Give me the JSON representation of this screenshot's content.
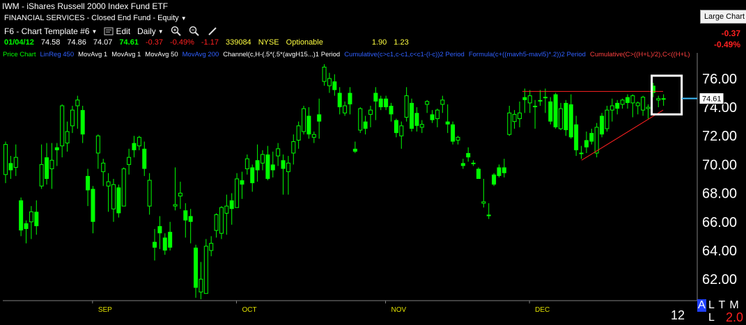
{
  "window": {
    "symbol": "IWM",
    "sep": " - ",
    "name": "iShares Russell 2000 Index Fund ETF",
    "sector": "FINANCIAL SERVICES - Closed End Fund - Equity"
  },
  "toolbar": {
    "template": "F6 - Chart Template #6",
    "edit": "Edit",
    "period": "Daily"
  },
  "quote": {
    "date": "01/04/12",
    "open": "74.58",
    "high": "74.86",
    "low": "74.07",
    "last": "74.61",
    "net": "-0.37",
    "pct": "-0.49%",
    "other": "-1.17",
    "volume": "339084",
    "exchange": "NYSE",
    "optionable": "Optionable",
    "v1": "1.90",
    "v2": "1.23"
  },
  "studies": [
    {
      "text": "Price Chart",
      "color": "green"
    },
    {
      "text": "LinReg 450",
      "color": "blue"
    },
    {
      "text": "MovAvg 1",
      "color": "white"
    },
    {
      "text": "MovAvg 1",
      "color": "white"
    },
    {
      "text": "MovAvg 50",
      "color": "white"
    },
    {
      "text": "MovAvg 200",
      "color": "blue"
    },
    {
      "text": "Channel(c,H-(.5*(.5*(avgH15...)1 Period",
      "color": "white"
    },
    {
      "text": "Cumulative(c>c1,c-c1,c<c1-(l-c))2 Period",
      "color": "blue"
    },
    {
      "text": "Formula(c+((mavh5-mavl5)*.2))2 Period",
      "color": "blue"
    },
    {
      "text": "Cumulative(C>((H+L)/2),C<((H+L)",
      "color": "red"
    }
  ],
  "large_chart_label": "Large Chart",
  "right_change": {
    "net": "-0.37",
    "pct": "-0.49%"
  },
  "last_price_tag": "74.61",
  "footer": {
    "period_num": "12",
    "a": "A",
    "ltml": "L T M L",
    "zoom": "2.0"
  },
  "colors": {
    "up": "#00ff00",
    "down": "#00ff00",
    "trend": "#ff2020",
    "price_tag": "#40c0ff",
    "highlight": "#ffffff"
  },
  "chart_data": {
    "type": "candlestick",
    "ylim": [
      60.5,
      77.5
    ],
    "yticks": [
      "76.00",
      "74.00",
      "72.00",
      "70.00",
      "68.00",
      "66.00",
      "64.00",
      "62.00"
    ],
    "months": [
      "SEP",
      "OCT",
      "NOV",
      "DEC"
    ],
    "candles": [
      [
        69.3,
        71.6,
        68.7,
        71.4
      ],
      [
        70.1,
        70.6,
        69.0,
        69.6
      ],
      [
        69.8,
        71.4,
        69.2,
        70.5
      ],
      [
        67.5,
        67.7,
        65.0,
        65.4
      ],
      [
        65.9,
        66.1,
        64.5,
        65.5
      ],
      [
        66.0,
        67.1,
        64.8,
        66.7
      ],
      [
        66.7,
        67.5,
        65.1,
        65.7
      ],
      [
        68.5,
        71.4,
        68.3,
        70.0
      ],
      [
        70.5,
        71.5,
        68.6,
        69.0
      ],
      [
        69.7,
        71.5,
        68.3,
        70.3
      ],
      [
        71.2,
        71.5,
        69.9,
        71.0
      ],
      [
        71.3,
        74.2,
        70.5,
        74.1
      ],
      [
        71.5,
        73.0,
        70.9,
        72.3
      ],
      [
        72.7,
        74.1,
        72.2,
        73.8
      ],
      [
        74.1,
        74.8,
        72.5,
        74.5
      ],
      [
        73.8,
        74.1,
        71.5,
        72.1
      ],
      [
        69.2,
        69.7,
        67.1,
        68.2
      ],
      [
        68.3,
        68.5,
        65.2,
        66.0
      ],
      [
        70.8,
        72.1,
        69.7,
        72.0
      ],
      [
        69.5,
        70.4,
        68.5,
        70.1
      ],
      [
        68.5,
        69.4,
        66.7,
        68.8
      ],
      [
        66.9,
        69.0,
        66.0,
        68.6
      ],
      [
        68.4,
        68.6,
        66.3,
        66.6
      ],
      [
        67.1,
        69.8,
        67.1,
        69.7
      ],
      [
        70.0,
        71.1,
        69.3,
        70.5
      ],
      [
        71.5,
        72.0,
        70.5,
        71.0
      ],
      [
        71.3,
        72.0,
        71.0,
        71.9
      ],
      [
        71.1,
        71.6,
        69.2,
        69.7
      ],
      [
        67.1,
        69.4,
        66.5,
        68.9
      ],
      [
        64.6,
        65.5,
        63.3,
        64.2
      ],
      [
        65.7,
        66.4,
        64.1,
        65.2
      ],
      [
        64.9,
        65.2,
        63.7,
        64.0
      ],
      [
        65.3,
        66.0,
        64.0,
        64.2
      ],
      [
        67.1,
        69.8,
        66.8,
        67.2
      ],
      [
        67.8,
        68.8,
        66.9,
        68.0
      ],
      [
        66.8,
        67.3,
        64.9,
        66.1
      ],
      [
        66.4,
        66.9,
        64.5,
        66.0
      ],
      [
        64.2,
        64.4,
        60.7,
        61.4
      ],
      [
        61.1,
        63.2,
        60.6,
        62.0
      ],
      [
        61.0,
        64.8,
        61.0,
        64.3
      ],
      [
        64.0,
        65.0,
        63.6,
        64.5
      ],
      [
        65.4,
        66.6,
        64.9,
        66.5
      ],
      [
        65.2,
        67.1,
        64.8,
        67.0
      ],
      [
        66.6,
        67.9,
        65.1,
        67.1
      ],
      [
        67.5,
        68.0,
        65.8,
        66.9
      ],
      [
        67.0,
        69.4,
        67.0,
        69.0
      ],
      [
        68.9,
        69.5,
        67.6,
        68.6
      ],
      [
        69.7,
        70.7,
        69.3,
        70.4
      ],
      [
        69.8,
        70.0,
        68.1,
        68.7
      ],
      [
        70.3,
        71.4,
        68.8,
        69.6
      ],
      [
        70.1,
        71.0,
        69.6,
        70.7
      ],
      [
        70.7,
        71.3,
        68.9,
        69.0
      ],
      [
        70.0,
        70.9,
        69.1,
        69.6
      ],
      [
        70.6,
        71.5,
        69.9,
        71.1
      ],
      [
        70.3,
        70.7,
        67.9,
        69.7
      ],
      [
        69.5,
        70.6,
        67.9,
        70.1
      ],
      [
        70.8,
        72.1,
        70.0,
        71.6
      ],
      [
        71.7,
        73.0,
        71.1,
        72.7
      ],
      [
        72.3,
        74.1,
        72.1,
        73.9
      ],
      [
        73.4,
        74.0,
        71.8,
        72.1
      ],
      [
        71.9,
        72.3,
        71.5,
        72.1
      ],
      [
        73.5,
        74.6,
        71.8,
        73.0
      ],
      [
        75.8,
        77.0,
        75.5,
        76.8
      ],
      [
        75.5,
        76.4,
        75.0,
        76.0
      ],
      [
        75.8,
        76.3,
        74.8,
        75.2
      ],
      [
        75.0,
        75.4,
        73.5,
        74.0
      ],
      [
        73.6,
        74.4,
        73.4,
        74.1
      ],
      [
        75.0,
        75.4,
        73.5,
        74.2
      ],
      [
        71.1,
        71.6,
        70.8,
        70.9
      ],
      [
        72.4,
        74.0,
        72.2,
        73.9
      ],
      [
        73.0,
        73.4,
        72.1,
        72.5
      ],
      [
        73.5,
        74.1,
        72.6,
        73.8
      ],
      [
        75.0,
        75.4,
        73.1,
        74.4
      ],
      [
        74.6,
        74.8,
        73.8,
        74.0
      ],
      [
        74.6,
        74.8,
        73.8,
        74.0
      ],
      [
        74.1,
        74.3,
        73.0,
        73.5
      ],
      [
        73.1,
        73.2,
        71.9,
        72.2
      ],
      [
        72.0,
        73.0,
        71.1,
        72.7
      ],
      [
        73.3,
        75.4,
        73.0,
        74.8
      ],
      [
        74.3,
        74.6,
        72.3,
        72.5
      ],
      [
        73.6,
        74.0,
        72.3,
        72.7
      ],
      [
        72.6,
        73.1,
        72.2,
        72.8
      ],
      [
        74.2,
        74.5,
        73.6,
        74.4
      ],
      [
        73.5,
        73.8,
        72.9,
        73.1
      ],
      [
        73.2,
        73.9,
        72.6,
        73.8
      ],
      [
        74.2,
        74.8,
        73.6,
        74.5
      ],
      [
        73.0,
        74.2,
        72.2,
        72.8
      ],
      [
        72.8,
        73.0,
        71.4,
        71.6
      ],
      [
        71.7,
        72.0,
        71.4,
        71.9
      ],
      [
        70.1,
        70.4,
        69.7,
        69.9
      ],
      [
        70.8,
        71.2,
        70.2,
        70.5
      ],
      [
        70.1,
        70.3,
        69.9,
        70.1
      ],
      [
        69.7,
        69.8,
        69.0,
        69.0
      ],
      [
        67.3,
        69.0,
        67.0,
        67.4
      ],
      [
        66.5,
        67.3,
        66.2,
        66.4
      ],
      [
        69.3,
        69.4,
        68.5,
        68.6
      ],
      [
        69.8,
        70.0,
        69.1,
        69.2
      ],
      [
        69.8,
        70.4,
        69.1,
        69.4
      ],
      [
        72.1,
        74.1,
        72.0,
        73.6
      ],
      [
        73.0,
        73.8,
        72.5,
        73.5
      ],
      [
        73.2,
        74.4,
        72.6,
        73.6
      ],
      [
        74.7,
        75.3,
        73.6,
        74.5
      ],
      [
        74.3,
        75.2,
        73.6,
        74.8
      ],
      [
        74.1,
        74.5,
        72.5,
        74.0
      ],
      [
        74.5,
        75.2,
        74.1,
        74.4
      ],
      [
        74.7,
        75.3,
        73.6,
        74.7
      ],
      [
        74.4,
        74.7,
        72.8,
        73.0
      ],
      [
        74.9,
        75.0,
        72.5,
        72.6
      ],
      [
        72.5,
        74.3,
        72.4,
        73.9
      ],
      [
        74.3,
        74.5,
        72.0,
        72.4
      ],
      [
        74.2,
        74.9,
        71.8,
        71.9
      ],
      [
        72.8,
        73.4,
        70.6,
        71.0
      ],
      [
        70.8,
        71.3,
        70.4,
        70.8
      ],
      [
        71.7,
        72.3,
        70.8,
        71.2
      ],
      [
        72.2,
        72.5,
        71.4,
        71.6
      ],
      [
        70.8,
        72.9,
        70.5,
        72.6
      ],
      [
        73.4,
        73.6,
        71.9,
        72.1
      ],
      [
        72.5,
        74.1,
        72.3,
        73.8
      ],
      [
        73.8,
        74.6,
        73.0,
        74.1
      ],
      [
        74.3,
        74.5,
        73.5,
        73.9
      ],
      [
        74.2,
        74.6,
        73.9,
        74.5
      ],
      [
        74.7,
        74.9,
        73.9,
        74.3
      ],
      [
        74.3,
        74.9,
        73.3,
        74.8
      ],
      [
        74.1,
        74.4,
        73.5,
        74.3
      ],
      [
        73.8,
        74.8,
        73.4,
        74.7
      ],
      [
        73.9,
        74.2,
        73.2,
        74.0
      ],
      [
        75.5,
        75.7,
        74.7,
        75.0
      ],
      [
        74.5,
        74.8,
        74.0,
        74.6
      ],
      [
        74.6,
        74.9,
        74.1,
        74.6
      ]
    ],
    "trend_lines": [
      {
        "from": [
          750,
          75.1
        ],
        "to": [
          952,
          75.1
        ]
      },
      {
        "from": [
          835,
          70.3
        ],
        "to": [
          952,
          73.8
        ]
      }
    ]
  }
}
